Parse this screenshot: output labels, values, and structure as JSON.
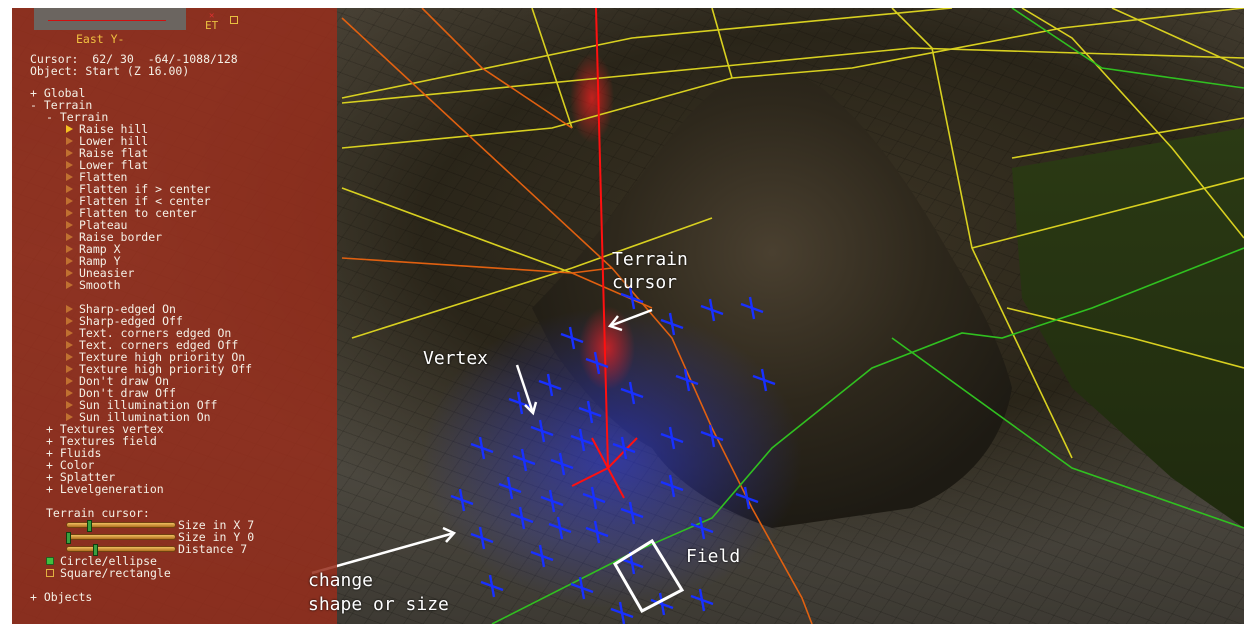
{
  "panel": {
    "view_mode": "East Y-",
    "et_label": "ET",
    "cursor_line": "Cursor:  62/ 30  -64/-1088/128",
    "object_line": "Object: Start (Z 16.00)",
    "tree": {
      "global": "+ Global",
      "terrain": "- Terrain",
      "terrain_sub": "- Terrain",
      "tools": [
        "Raise hill",
        "Lower hill",
        "Raise flat",
        "Lower flat",
        "Flatten",
        "Flatten if > center",
        "Flatten if < center",
        "Flatten to center",
        "Plateau",
        "Raise border",
        "Ramp X",
        "Ramp Y",
        "Uneasier",
        "Smooth"
      ],
      "options": [
        "Sharp-edged On",
        "Sharp-edged Off",
        "Text. corners edged On",
        "Text. corners edged Off",
        "Texture high priority On",
        "Texture high priority Off",
        "Don't draw On",
        "Don't draw Off",
        "Sun illumination Off",
        "Sun illumination On"
      ],
      "groups": [
        "+ Textures vertex",
        "+ Textures field",
        "+ Fluids",
        "+ Color",
        "+ Splatter",
        "+ Levelgeneration"
      ],
      "cursor_header": "Terrain cursor:",
      "sliders": [
        {
          "label": "Size in X 7",
          "value": 0.2
        },
        {
          "label": "Size in Y 0",
          "value": 0.0
        },
        {
          "label": "Distance 7",
          "value": 0.25
        }
      ],
      "shapes": [
        {
          "label": "Circle/ellipse",
          "selected": true
        },
        {
          "label": "Square/rectangle",
          "selected": false
        }
      ],
      "objects": "+ Objects"
    }
  },
  "annotations": {
    "terrain_cursor_1": "Terrain",
    "terrain_cursor_2": "cursor",
    "vertex": "Vertex",
    "field": "Field",
    "change_1": "change",
    "change_2": "shape or size"
  },
  "colors": {
    "panel_bg": "#962d1c",
    "grid_yellow": "#d8d020",
    "grid_orange": "#e06010",
    "grid_green": "#30c020",
    "vertex_blue": "#1830ff",
    "cursor_red": "#ff1010"
  }
}
